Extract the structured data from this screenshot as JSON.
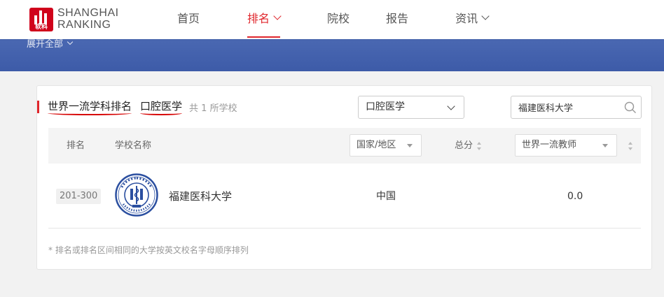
{
  "header": {
    "logo_cn": "软科",
    "logo_line1": "SHANGHAI",
    "logo_line2": "RANKING",
    "nav": [
      {
        "label": "首页",
        "dropdown": false,
        "active": false
      },
      {
        "label": "排名",
        "dropdown": true,
        "active": true
      },
      {
        "label": "院校",
        "dropdown": false,
        "active": false
      },
      {
        "label": "报告",
        "dropdown": false,
        "active": false
      },
      {
        "label": "资讯",
        "dropdown": true,
        "active": false
      }
    ]
  },
  "banner": {
    "expand_label": "展开全部"
  },
  "ranking": {
    "title": "世界一流学科排名",
    "subject": "口腔医学",
    "count_text": "共 1 所学校",
    "subject_select": "口腔医学",
    "search_value": "福建医科大学",
    "columns": {
      "rank": "排名",
      "school": "学校名称",
      "region_filter": "国家/地区",
      "total": "总分",
      "indicator_filter": "世界一流教师"
    },
    "rows": [
      {
        "rank": "201-300",
        "name": "福建医科大学",
        "country": "中国",
        "score": "0.0",
        "emblem": "university-emblem"
      }
    ],
    "footnote": "* 排名或排名区间相同的大学按英文校名字母顺序排列"
  },
  "colors": {
    "accent": "#e0262c",
    "banner": "#3d5ba8",
    "emblem": "#2b4fa0"
  }
}
